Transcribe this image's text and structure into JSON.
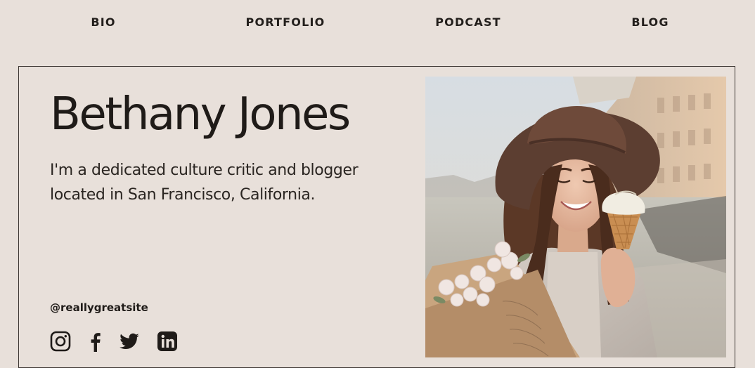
{
  "nav": {
    "items": [
      {
        "label": "BIO"
      },
      {
        "label": "PORTFOLIO"
      },
      {
        "label": "PODCAST"
      },
      {
        "label": "BLOG"
      }
    ]
  },
  "profile": {
    "name": "Bethany Jones",
    "tagline_line1": "I'm a dedicated culture critic and blogger",
    "tagline_line2": "located in San Francisco, California.",
    "handle": "@reallygreatsite"
  },
  "social_icons": [
    "instagram-icon",
    "facebook-icon",
    "twitter-icon",
    "linkedin-icon"
  ],
  "colors": {
    "background": "#e8e0da",
    "text": "#1f1b18",
    "border": "#3a3430"
  }
}
